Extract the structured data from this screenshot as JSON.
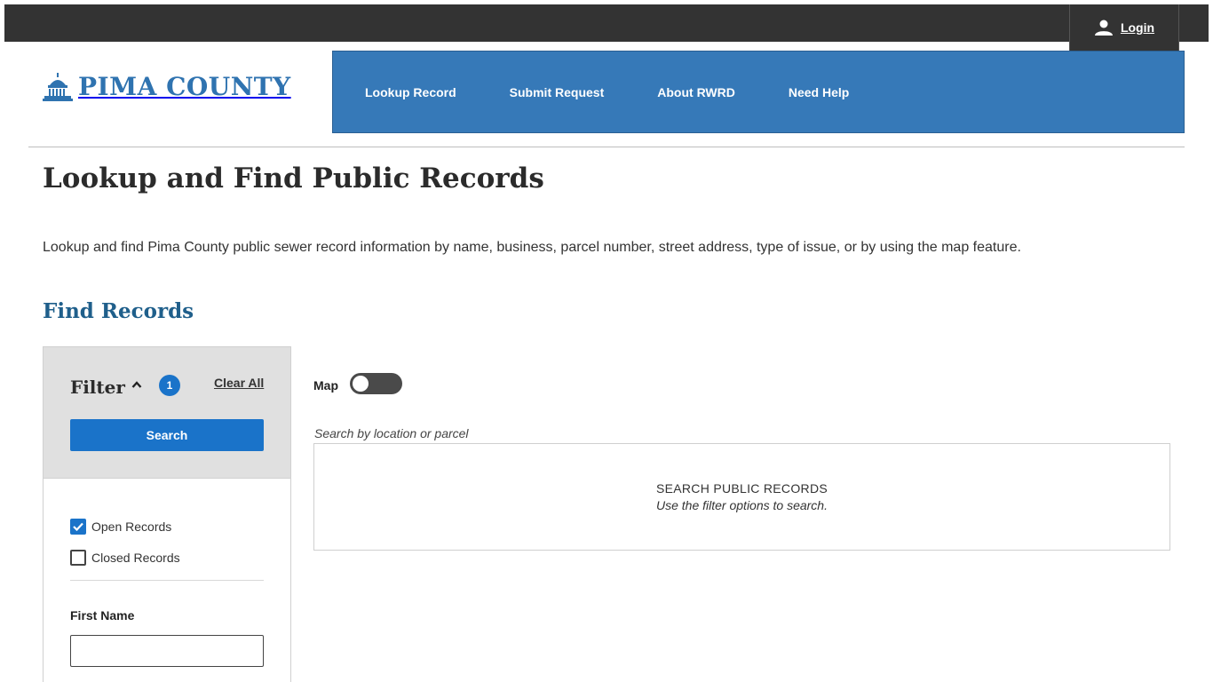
{
  "header": {
    "login_label": "Login",
    "logo_text": "PIMA COUNTY"
  },
  "nav": {
    "items": [
      {
        "label": "Lookup Record"
      },
      {
        "label": "Submit Request"
      },
      {
        "label": "About RWRD"
      },
      {
        "label": "Need Help"
      }
    ]
  },
  "page": {
    "title": "Lookup and Find Public Records",
    "intro": "Lookup and find Pima County public sewer record information by name, business, parcel number, street address, type of issue, or by using the map feature.",
    "section_title": "Find Records"
  },
  "filter": {
    "label": "Filter",
    "count": "1",
    "clear_all_label": "Clear All",
    "search_label": "Search",
    "open_records_label": "Open Records",
    "open_records_checked": true,
    "closed_records_label": "Closed Records",
    "closed_records_checked": false,
    "first_name_label": "First Name",
    "first_name_value": ""
  },
  "map": {
    "label": "Map",
    "enabled": false
  },
  "results": {
    "caption": "Search by location or parcel",
    "title": "SEARCH PUBLIC RECORDS",
    "hint": "Use the filter options to search."
  },
  "colors": {
    "topbar": "#333333",
    "nav_bg": "#3679b8",
    "brand_blue": "#2f73b0",
    "button_blue": "#1a73c9",
    "section_title": "#1f5f8b"
  }
}
